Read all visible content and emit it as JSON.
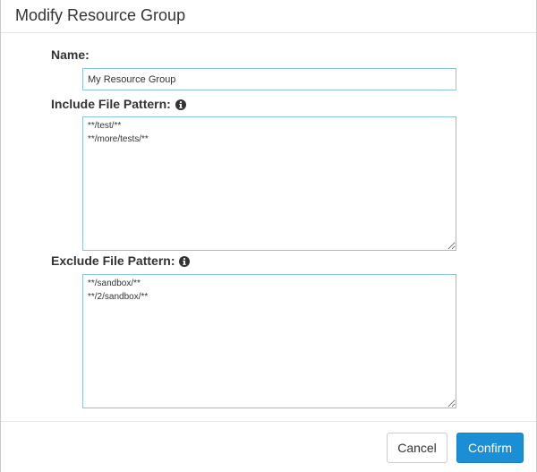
{
  "dialog": {
    "title": "Modify Resource Group"
  },
  "fields": {
    "name": {
      "label": "Name:",
      "value": "My Resource Group"
    },
    "include": {
      "label": "Include File Pattern:",
      "value": "**/test/**\n**/more/tests/**",
      "icon": "info-circle-icon"
    },
    "exclude": {
      "label": "Exclude File Pattern:",
      "value": "**/sandbox/**\n**/2/sandbox/**",
      "icon": "info-circle-icon"
    }
  },
  "footer": {
    "cancel_label": "Cancel",
    "confirm_label": "Confirm"
  },
  "colors": {
    "confirm_button": "#1a8fd6",
    "input_border": "#8fc0e8"
  }
}
